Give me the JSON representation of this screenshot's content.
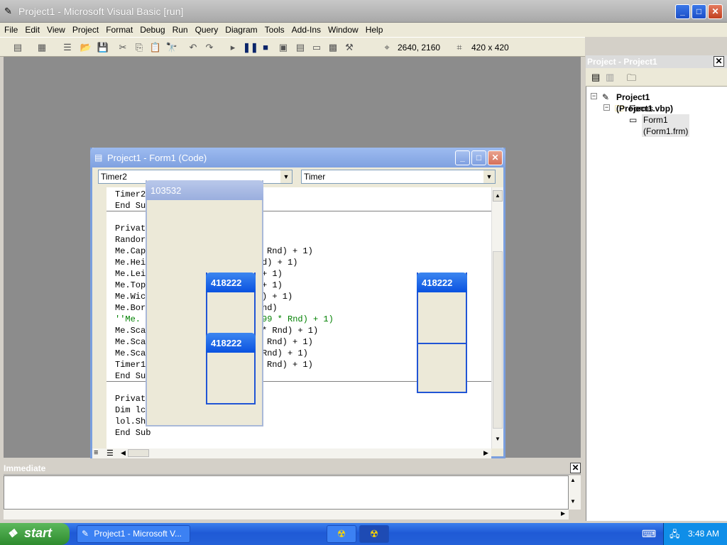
{
  "window": {
    "title": "Project1 - Microsoft Visual Basic [run]"
  },
  "menu": [
    "File",
    "Edit",
    "View",
    "Project",
    "Format",
    "Debug",
    "Run",
    "Query",
    "Diagram",
    "Tools",
    "Add-Ins",
    "Window",
    "Help"
  ],
  "toolbar": {
    "position": "2640, 2160",
    "size": "420 x 420"
  },
  "project": {
    "title": "Project - Project1",
    "root": "Project1 (Project1.vbp)",
    "folder": "Forms",
    "form": "Form1 (Form1.frm)"
  },
  "codewindow": {
    "title": "Project1 - Form1 (Code)",
    "object_combo": "Timer2",
    "proc_combo": "Timer",
    "lines": [
      {
        "t": "Timer2",
        "c": "black"
      },
      {
        "t": "End Su",
        "c": "black"
      },
      {
        "t": "Privat",
        "c": "black"
      },
      {
        "t": "Randor",
        "c": "black"
      },
      {
        "t": "Me.Cap",
        "c": "black"
      },
      {
        "t": "Me.Hei",
        "c": "black"
      },
      {
        "t": "Me.Lei",
        "c": "black"
      },
      {
        "t": "Me.Top",
        "c": "black"
      },
      {
        "t": "Me.Wic",
        "c": "black"
      },
      {
        "t": "Me.Bor",
        "c": "black"
      },
      {
        "t": "''Me.",
        "c": "green"
      },
      {
        "t": "Me.Sca",
        "c": "black"
      },
      {
        "t": "Me.Sca",
        "c": "black"
      },
      {
        "t": "Me.Sca",
        "c": "black"
      },
      {
        "t": "Timer1",
        "c": "black"
      },
      {
        "t": "End Su",
        "c": "black"
      },
      {
        "t": "Privat",
        "c": "black"
      },
      {
        "t": "Dim lc",
        "c": "black"
      },
      {
        "t": "lol.Sh",
        "c": "black"
      },
      {
        "t": "End Sub",
        "c": "black"
      }
    ],
    "right_fragments": [
      "Rnd) + 1)",
      "d) + 1)",
      "+ 1)",
      "+ 1)",
      ") + 1)",
      "nd)",
      "99 * Rnd) + 1)",
      "* Rnd) + 1)",
      "Rnd) + 1)",
      "Rnd) + 1)",
      "Rnd) + 1)"
    ]
  },
  "forms": {
    "form_a": "103532",
    "form_b": "418222",
    "form_c": "418222",
    "form_d": "418222"
  },
  "immediate": {
    "title": "Immediate"
  },
  "taskbar": {
    "start": "start",
    "task": "Project1 - Microsoft V...",
    "clock": "3:48 AM"
  }
}
